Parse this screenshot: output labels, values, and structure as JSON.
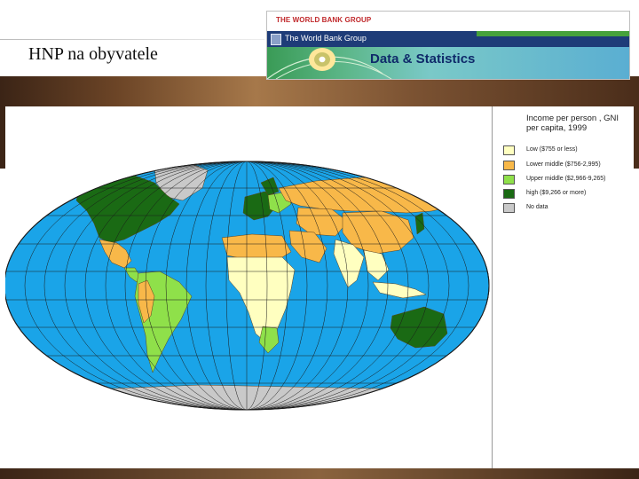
{
  "slide": {
    "title": "HNP na obyvatele"
  },
  "logo": {
    "group_name": "THE WORLD BANK GROUP",
    "bar_text": "The World Bank Group",
    "band_text": "Data & Statistics"
  },
  "map": {
    "legend": {
      "title": "Income per person , GNI per capita, 1999",
      "items": [
        {
          "label": "Low ($755 or less)",
          "color": "#ffffc0"
        },
        {
          "label": "Lower middle ($756-2,995)",
          "color": "#f8b849"
        },
        {
          "label": "Upper middle ($2,966-9,265)",
          "color": "#8fe04a"
        },
        {
          "label": "high ($9,266 or more)",
          "color": "#1a6a14"
        },
        {
          "label": "No data",
          "color": "#c9c9c9"
        }
      ]
    },
    "colors": {
      "ocean": "#1aa4e8",
      "graticule": "#1a1a1a",
      "border": "#5a4020"
    }
  }
}
